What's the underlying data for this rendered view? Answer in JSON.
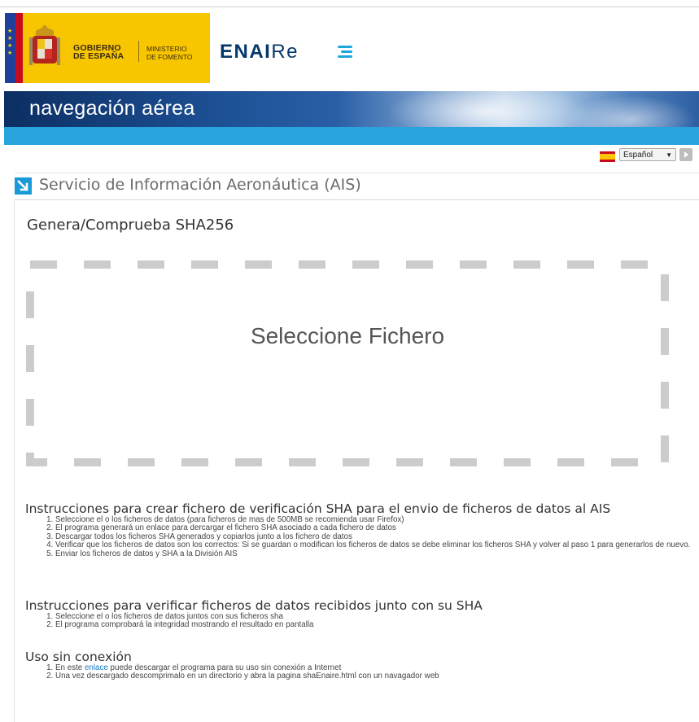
{
  "header": {
    "gobierno_line1": "GOBIERNO",
    "gobierno_line2": "DE ESPAÑA",
    "ministerio_line1": "MINISTERIO",
    "ministerio_line2": "DE FOMENTO",
    "enaire_bold": "ENAI",
    "enaire_thin": "Re"
  },
  "banner": {
    "title": "navegación aérea"
  },
  "language": {
    "selected": "Español"
  },
  "section": {
    "title": "Servicio de Información Aeronáutica (AIS)"
  },
  "page": {
    "title": "Genera/Comprueba SHA256"
  },
  "dropzone": {
    "label": "Seleccione Fichero"
  },
  "instructions_create": {
    "heading": "Instrucciones para crear fichero de verificación SHA para el envio de ficheros de datos al AIS",
    "items": [
      "Seleccione el o los ficheros de datos (para ficheros de mas de 500MB se recomienda usar Firefox)",
      "El programa generará un enlace para dercargar el fichero SHA asociado a cada fichero de datos",
      "Descargar todos los ficheros SHA generados y copiarlos junto a los fichero de datos",
      "Verificar que los ficheros de datos son los correctos: Si se guardan o modifican los ficheros de datos se debe eliminar los ficheros SHA y volver al paso 1 para generarlos de nuevo.",
      "Enviar los ficheros de datos y SHA a la División AIS"
    ]
  },
  "instructions_verify": {
    "heading": "Instrucciones para verificar ficheros de datos recibidos junto con su SHA",
    "items": [
      "Seleccione el o los ficheros de datos juntos con sus ficheros sha",
      "El programa comprobará la integridad mostrando el resultado en pantalla"
    ]
  },
  "offline": {
    "heading": "Uso sin conexión",
    "item1_prefix": "En este ",
    "item1_link": "enlace",
    "item1_suffix": " puede descargar el programa para su uso sin conexión a Internet",
    "item2": "Una vez descargado descomprimalo en un directorio y abra la pagina shaEnaire.html con un navagador web"
  }
}
